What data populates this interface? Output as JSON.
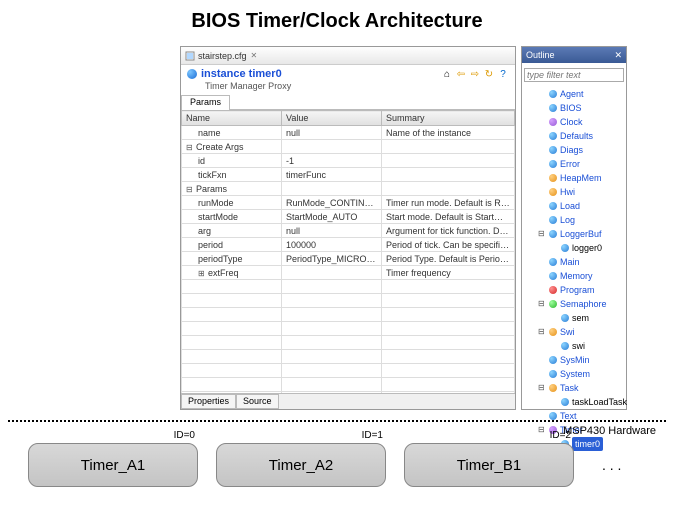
{
  "title": "BIOS Timer/Clock Architecture",
  "editor": {
    "tab_name": "stairstep.cfg",
    "instance_name": "instance timer0",
    "subtitle": "Timer Manager Proxy",
    "params_tab": "Params",
    "bottom_tabs": {
      "properties": "Properties",
      "source": "Source"
    },
    "columns": {
      "name": "Name",
      "value": "Value",
      "summary": "Summary"
    },
    "rows": [
      {
        "name": "name",
        "value": "null",
        "summary": "Name of the instance",
        "indent": 1
      },
      {
        "name": "Create Args",
        "value": "",
        "summary": "",
        "indent": 0,
        "expanded": true
      },
      {
        "name": "id",
        "value": "-1",
        "summary": "",
        "indent": 1
      },
      {
        "name": "tickFxn",
        "value": "timerFunc",
        "summary": "",
        "indent": 1
      },
      {
        "name": "Params",
        "value": "",
        "summary": "",
        "indent": 0,
        "expanded": true
      },
      {
        "name": "runMode",
        "value": "RunMode_CONTINUOUS",
        "summary": "Timer run mode. Default is RunMode_CONT...",
        "indent": 1
      },
      {
        "name": "startMode",
        "value": "StartMode_AUTO",
        "summary": "Start mode. Default is StartMode_AUTO",
        "indent": 1
      },
      {
        "name": "arg",
        "value": "null",
        "summary": "Argument for tick function. Default is null",
        "indent": 1
      },
      {
        "name": "period",
        "value": "100000",
        "summary": "Period of tick. Can be specified in timer coun...",
        "indent": 1
      },
      {
        "name": "periodType",
        "value": "PeriodType_MICROSECS",
        "summary": "Period Type. Default is PeriodType_MICROS...",
        "indent": 1
      },
      {
        "name": "extFreq",
        "value": "",
        "summary": "Timer frequency",
        "indent": 1,
        "collapsed": true
      }
    ]
  },
  "outline": {
    "title": "Outline",
    "filter_placeholder": "type filter text",
    "nodes": [
      {
        "label": "Agent",
        "dot": "dot-blue",
        "indent": 1
      },
      {
        "label": "BIOS",
        "dot": "dot-blue",
        "indent": 1
      },
      {
        "label": "Clock",
        "dot": "dot-purple",
        "indent": 1
      },
      {
        "label": "Defaults",
        "dot": "dot-blue",
        "indent": 1
      },
      {
        "label": "Diags",
        "dot": "dot-blue",
        "indent": 1
      },
      {
        "label": "Error",
        "dot": "dot-blue",
        "indent": 1
      },
      {
        "label": "HeapMem",
        "dot": "dot-orange",
        "indent": 1
      },
      {
        "label": "Hwi",
        "dot": "dot-orange",
        "indent": 1
      },
      {
        "label": "Load",
        "dot": "dot-blue",
        "indent": 1
      },
      {
        "label": "Log",
        "dot": "dot-blue",
        "indent": 1
      },
      {
        "label": "LoggerBuf",
        "dot": "dot-blue",
        "indent": 1,
        "expandable": true
      },
      {
        "label": "logger0",
        "dot": "dot-blue",
        "indent": 2,
        "black": true
      },
      {
        "label": "Main",
        "dot": "dot-blue",
        "indent": 1
      },
      {
        "label": "Memory",
        "dot": "dot-blue",
        "indent": 1
      },
      {
        "label": "Program",
        "dot": "dot-red",
        "indent": 1
      },
      {
        "label": "Semaphore",
        "dot": "dot-green",
        "indent": 1,
        "expandable": true
      },
      {
        "label": "sem",
        "dot": "dot-blue",
        "indent": 2,
        "black": true
      },
      {
        "label": "Swi",
        "dot": "dot-orange",
        "indent": 1,
        "expandable": true
      },
      {
        "label": "swi",
        "dot": "dot-blue",
        "indent": 2,
        "black": true
      },
      {
        "label": "SysMin",
        "dot": "dot-blue",
        "indent": 1
      },
      {
        "label": "System",
        "dot": "dot-blue",
        "indent": 1
      },
      {
        "label": "Task",
        "dot": "dot-orange",
        "indent": 1,
        "expandable": true
      },
      {
        "label": "taskLoadTask",
        "dot": "dot-blue",
        "indent": 2,
        "black": true
      },
      {
        "label": "Text",
        "dot": "dot-blue",
        "indent": 1
      },
      {
        "label": "Timer",
        "dot": "dot-purple",
        "indent": 1,
        "expandable": true
      },
      {
        "label": "timer0",
        "dot": "dot-blue",
        "indent": 2,
        "selected": true
      }
    ]
  },
  "hardware": {
    "label": "MSP430 Hardware",
    "timers": [
      {
        "name": "Timer_A1",
        "id": "ID=0"
      },
      {
        "name": "Timer_A2",
        "id": "ID=1"
      },
      {
        "name": "Timer_B1",
        "id": "ID=2"
      }
    ],
    "more": ". . ."
  }
}
